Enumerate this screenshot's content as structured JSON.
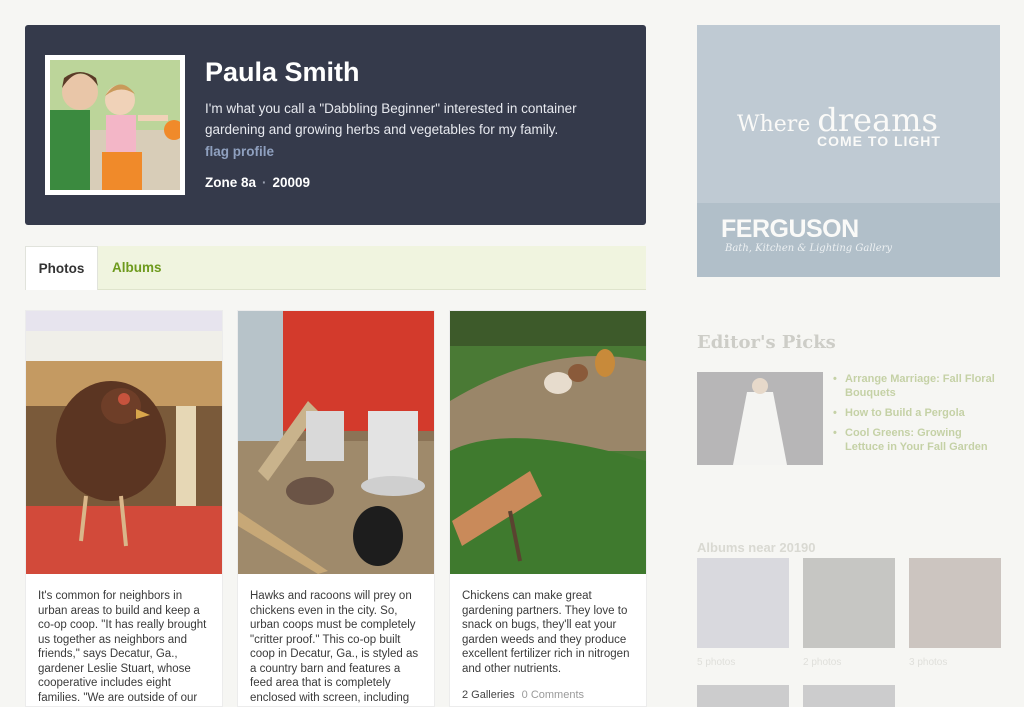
{
  "profile": {
    "name": "Paula Smith",
    "bio": "I'm what you call a \"Dabbling Beginner\" interested in container gardening and growing herbs and vegetables for my family.",
    "flag_link": "flag profile",
    "zone": "Zone 8a",
    "zip": "20009",
    "separator": "·"
  },
  "tabs": [
    {
      "label": "Photos",
      "active": true
    },
    {
      "label": "Albums",
      "active": false
    }
  ],
  "photos": [
    {
      "subject": "hen-in-coop",
      "caption": "It's common for neighbors in urban areas to build and keep a co-op coop. \"It has really brought us together as neighbors and friends,\" says Decatur, Ga., gardener Leslie Stuart, whose cooperative includes eight families. \"We are outside of our homes more and"
    },
    {
      "subject": "coop-feeders",
      "caption": "Hawks and racoons will prey on chickens even in the city. So, urban coops must be completely \"critter proof.\" This co-op built coop in Decatur, Ga., is styled as a country barn and features a feed area that is completely enclosed with screen, including the floor."
    },
    {
      "subject": "chickens-in-garden",
      "caption": "Chickens can make great gardening partners. They love to snack on bugs, they'll eat your garden weeds and they produce excellent fertilizer rich in nitrogen and other nutrients.",
      "galleries": "2 Galleries",
      "comments": "0 Comments"
    }
  ],
  "ad": {
    "where": "Where",
    "dreams": "dreams",
    "come": "COME TO LIGHT",
    "brand": "FERGUSON",
    "sub": "Bath, Kitchen & Lighting Gallery"
  },
  "editors_picks": {
    "title": "Editor's Picks",
    "items": [
      "Arrange Marriage: Fall Floral Bouquets",
      "How to Build a Pergola",
      "Cool Greens: Growing Lettuce in Your Fall Garden"
    ]
  },
  "albums_near": {
    "title": "Albums near 20190",
    "albums": [
      {
        "label": "5 photos"
      },
      {
        "label": "2 photos"
      },
      {
        "label": "3 photos"
      }
    ]
  },
  "colors": {
    "header_bg": "#353a4b",
    "tab_link": "#6e9a1d",
    "flag_link": "#8fa0bf"
  }
}
